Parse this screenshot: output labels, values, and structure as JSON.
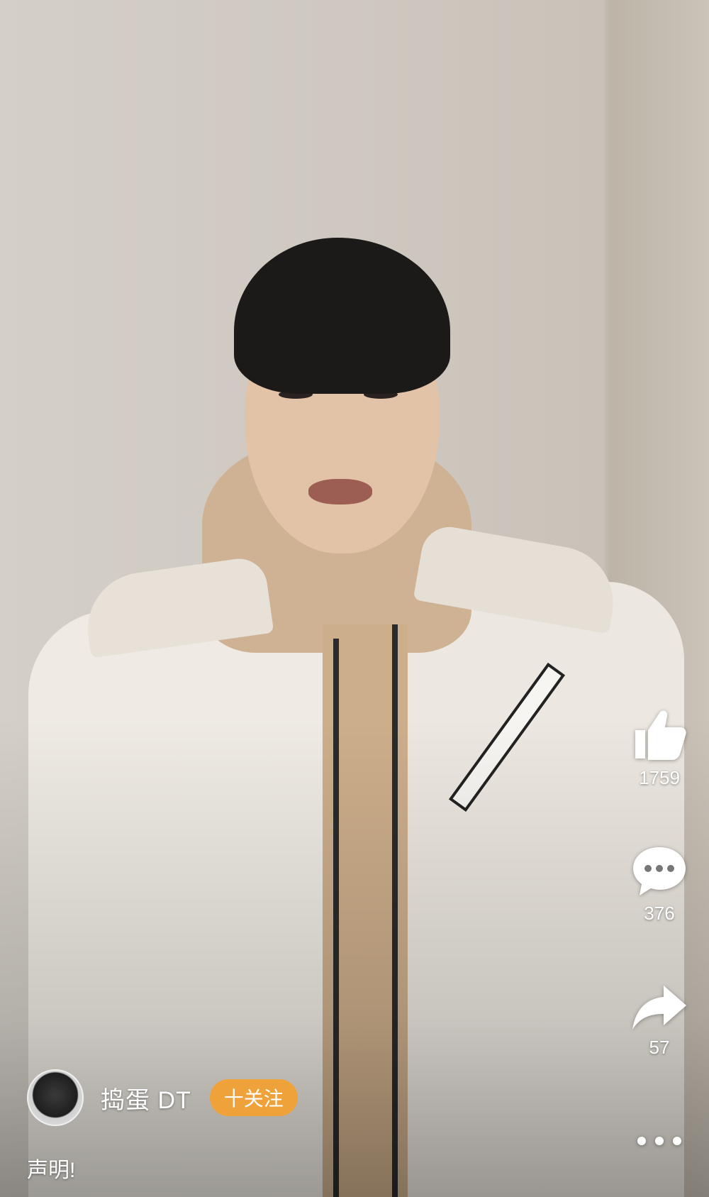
{
  "actions": {
    "like": {
      "icon": "thumbs-up-icon",
      "count": "1759"
    },
    "comment": {
      "icon": "comment-bubble-icon",
      "count": "376"
    },
    "share": {
      "icon": "share-arrow-icon",
      "count": "57"
    },
    "more": {
      "icon": "more-dots-icon"
    }
  },
  "author": {
    "name": "捣蛋 DT",
    "follow_label": "十关注"
  },
  "caption": "声明!",
  "colors": {
    "follow_button": "#f0a23a",
    "overlay_text": "#ffffff"
  }
}
